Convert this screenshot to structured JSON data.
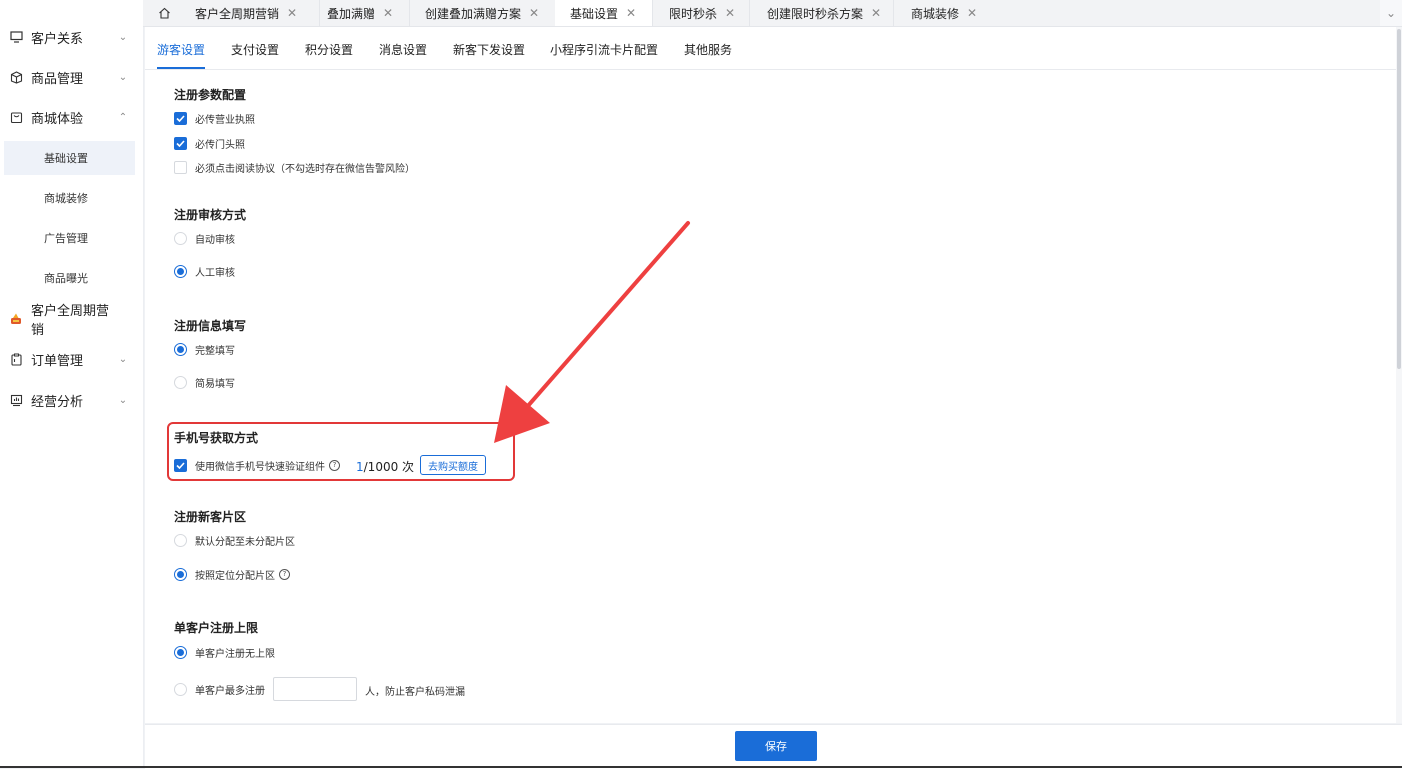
{
  "sidebar": {
    "groups": [
      {
        "label": "客户关系",
        "icon": "monitor-icon"
      },
      {
        "label": "商品管理",
        "icon": "box-icon"
      },
      {
        "label": "商城体验",
        "icon": "store-icon"
      },
      {
        "label": "客户全周期营销",
        "icon": "marketing-icon"
      },
      {
        "label": "订单管理",
        "icon": "clipboard-icon"
      },
      {
        "label": "经营分析",
        "icon": "chart-icon"
      }
    ],
    "subitems": [
      {
        "label": "基础设置",
        "active": true
      },
      {
        "label": "商城装修"
      },
      {
        "label": "广告管理"
      },
      {
        "label": "商品曝光"
      }
    ]
  },
  "tabs": [
    {
      "label": "客户全周期营销"
    },
    {
      "label": "叠加满赠"
    },
    {
      "label": "创建叠加满赠方案"
    },
    {
      "label": "基础设置",
      "active": true
    },
    {
      "label": "限时秒杀"
    },
    {
      "label": "创建限时秒杀方案"
    },
    {
      "label": "商城装修"
    }
  ],
  "subtabs": [
    {
      "label": "游客设置",
      "active": true
    },
    {
      "label": "支付设置"
    },
    {
      "label": "积分设置"
    },
    {
      "label": "消息设置"
    },
    {
      "label": "新客下发设置"
    },
    {
      "label": "小程序引流卡片配置"
    },
    {
      "label": "其他服务"
    }
  ],
  "sections": {
    "register_params": {
      "title": "注册参数配置",
      "options": [
        {
          "label": "必传营业执照",
          "checked": true
        },
        {
          "label": "必传门头照",
          "checked": true
        },
        {
          "label": "必须点击阅读协议（不勾选时存在微信告警风险）",
          "checked": false
        }
      ]
    },
    "review_method": {
      "title": "注册审核方式",
      "options": [
        {
          "label": "自动审核",
          "selected": false
        },
        {
          "label": "人工审核",
          "selected": true
        }
      ]
    },
    "info_fill": {
      "title": "注册信息填写",
      "options": [
        {
          "label": "完整填写",
          "selected": true
        },
        {
          "label": "简易填写",
          "selected": false
        }
      ]
    },
    "phone_method": {
      "title": "手机号获取方式",
      "option_label": "使用微信手机号快速验证组件",
      "checked": true,
      "help_symbol": "?",
      "quota_used": "1",
      "quota_rest": "/1000 次",
      "buy_button": "去购买额度"
    },
    "new_customer_zone": {
      "title": "注册新客片区",
      "options": [
        {
          "label": "默认分配至未分配片区",
          "selected": false
        },
        {
          "label": "按照定位分配片区",
          "selected": true
        }
      ],
      "help_symbol": "?"
    },
    "register_limit": {
      "title": "单客户注册上限",
      "options": [
        {
          "label": "单客户注册无上限",
          "selected": true
        },
        {
          "label": "单客户最多注册",
          "selected": false
        }
      ],
      "input_value": "",
      "suffix": "人，防止客户私码泄漏"
    }
  },
  "footer": {
    "save_label": "保存"
  },
  "colors": {
    "accent": "#1a6dd8",
    "highlight": "#e23838",
    "arrow": "#ee4040"
  }
}
